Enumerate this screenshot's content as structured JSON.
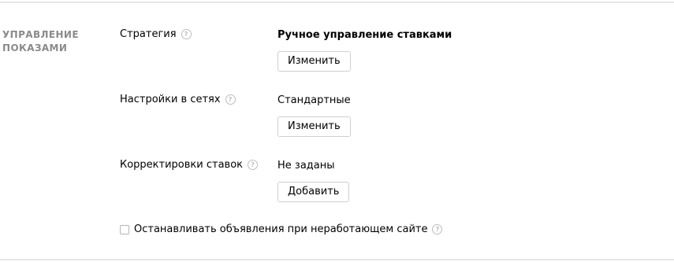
{
  "section": {
    "title_line1": "УПРАВЛЕНИЕ",
    "title_line2": "ПОКАЗАМИ"
  },
  "strategy": {
    "label": "Стратегия",
    "value": "Ручное управление ставками",
    "button": "Изменить"
  },
  "networks": {
    "label": "Настройки в сетях",
    "value": "Стандартные",
    "button": "Изменить"
  },
  "bid_adjustments": {
    "label": "Корректировки ставок",
    "value": "Не заданы",
    "button": "Добавить"
  },
  "stop_ads": {
    "label": "Останавливать объявления при неработающем сайте",
    "checked": false
  },
  "help_icon_glyph": "?"
}
